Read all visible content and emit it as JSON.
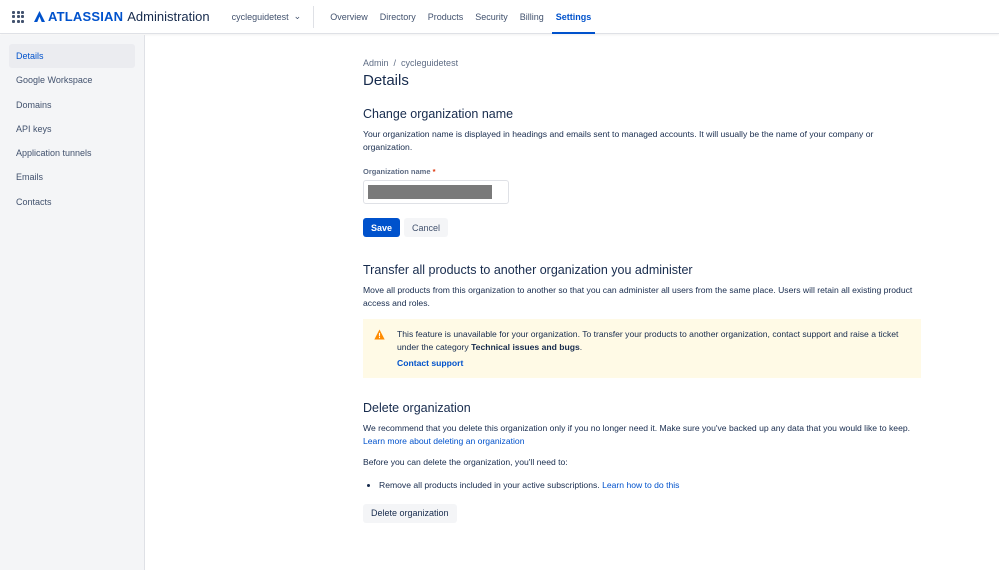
{
  "header": {
    "brand": "ATLASSIAN",
    "product": "Administration",
    "org": "cycleguidetest",
    "nav": [
      "Overview",
      "Directory",
      "Products",
      "Security",
      "Billing",
      "Settings"
    ]
  },
  "sidebar": {
    "items": [
      "Details",
      "Google Workspace",
      "Domains",
      "API keys",
      "Application tunnels",
      "Emails",
      "Contacts"
    ]
  },
  "main": {
    "breadcrumb": [
      "Admin",
      "cycleguidetest"
    ],
    "title": "Details",
    "change": {
      "heading": "Change organization name",
      "desc": "Your organization name is displayed in headings and emails sent to managed accounts. It will usually be the name of your company or organization.",
      "label": "Organization name",
      "required": "*",
      "save": "Save",
      "cancel": "Cancel"
    },
    "transfer": {
      "heading": "Transfer all products to another organization you administer",
      "desc": "Move all products from this organization to another so that you can administer all users from the same place. Users will retain all existing product access and roles.",
      "warn_text": "This feature is unavailable for your organization. To transfer your products to another organization, contact support and raise a ticket under the category ",
      "warn_bold": "Technical issues and bugs",
      "warn_end": ".",
      "link": "Contact support"
    },
    "delete": {
      "heading": "Delete organization",
      "desc": "We recommend that you delete this organization only if you no longer need it. Make sure you've backed up any data that you would like to keep. ",
      "desc_link": "Learn more about deleting an organization",
      "before": "Before you can delete the organization, you'll need to:",
      "item": "Remove all products included in your active subscriptions. ",
      "item_link": "Learn how to do this",
      "button": "Delete organization"
    }
  }
}
